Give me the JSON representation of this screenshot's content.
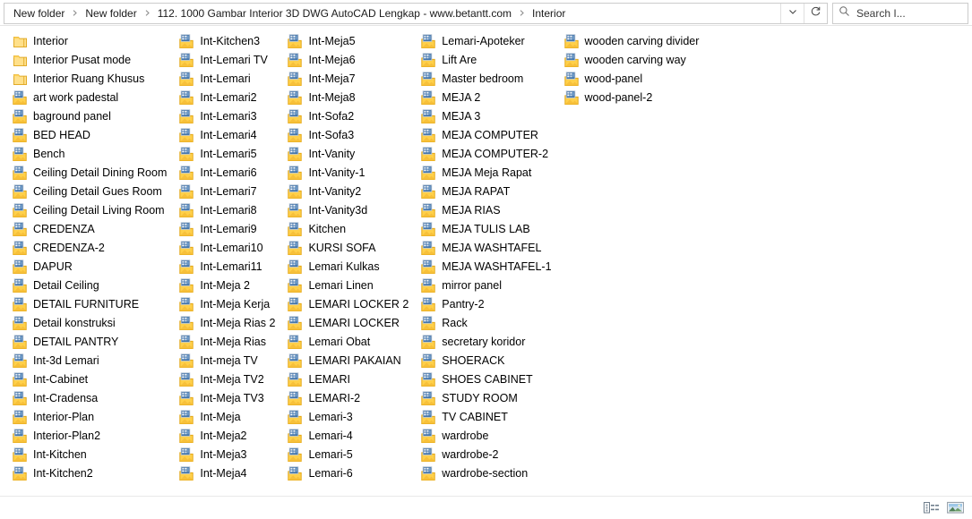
{
  "window": {
    "title": "Interior"
  },
  "addressbar": {
    "breadcrumbs": [
      {
        "label": "New folder"
      },
      {
        "label": "New folder"
      },
      {
        "label": "112. 1000 Gambar Interior 3D DWG AutoCAD Lengkap - www.betantt.com"
      },
      {
        "label": "Interior"
      }
    ],
    "separator_icon": "chevron-right-icon",
    "history_dropdown_icon": "chevron-down-icon",
    "refresh_icon": "refresh-icon"
  },
  "search": {
    "icon": "search-icon",
    "value": "",
    "placeholder": "Search I..."
  },
  "statusbar": {
    "view_details_icon": "details-view-icon",
    "view_large_icons_icon": "large-icons-view-icon"
  },
  "icons": {
    "folder_plain": "folder-icon",
    "folder_thumbnail": "folder-with-picture-icon"
  },
  "filelist": {
    "columns": [
      {
        "items": [
          {
            "name": "Interior",
            "icon": "folder-icon"
          },
          {
            "name": "Interior Pusat mode",
            "icon": "folder-icon"
          },
          {
            "name": "Interior Ruang Khusus",
            "icon": "folder-icon"
          },
          {
            "name": "art work padestal",
            "icon": "folder-with-picture-icon"
          },
          {
            "name": "baground panel",
            "icon": "folder-with-picture-icon"
          },
          {
            "name": "BED HEAD",
            "icon": "folder-with-picture-icon"
          },
          {
            "name": "Bench",
            "icon": "folder-with-picture-icon"
          },
          {
            "name": "Ceiling Detail Dining Room",
            "icon": "folder-with-picture-icon"
          },
          {
            "name": "Ceiling Detail Gues Room",
            "icon": "folder-with-picture-icon"
          },
          {
            "name": "Ceiling Detail Living Room",
            "icon": "folder-with-picture-icon"
          },
          {
            "name": "CREDENZA",
            "icon": "folder-with-picture-icon"
          },
          {
            "name": "CREDENZA-2",
            "icon": "folder-with-picture-icon"
          },
          {
            "name": "DAPUR",
            "icon": "folder-with-picture-icon"
          },
          {
            "name": "Detail Ceiling",
            "icon": "folder-with-picture-icon"
          },
          {
            "name": "DETAIL FURNITURE",
            "icon": "folder-with-picture-icon"
          },
          {
            "name": "Detail konstruksi",
            "icon": "folder-with-picture-icon"
          },
          {
            "name": "DETAIL PANTRY",
            "icon": "folder-with-picture-icon"
          },
          {
            "name": "Int-3d Lemari",
            "icon": "folder-with-picture-icon"
          },
          {
            "name": "Int-Cabinet",
            "icon": "folder-with-picture-icon"
          },
          {
            "name": "Int-Cradensa",
            "icon": "folder-with-picture-icon"
          },
          {
            "name": "Interior-Plan",
            "icon": "folder-with-picture-icon"
          },
          {
            "name": "Interior-Plan2",
            "icon": "folder-with-picture-icon"
          },
          {
            "name": "Int-Kitchen",
            "icon": "folder-with-picture-icon"
          },
          {
            "name": "Int-Kitchen2",
            "icon": "folder-with-picture-icon"
          }
        ]
      },
      {
        "items": [
          {
            "name": "Int-Kitchen3",
            "icon": "folder-with-picture-icon"
          },
          {
            "name": "Int-Lemari TV",
            "icon": "folder-with-picture-icon"
          },
          {
            "name": "Int-Lemari",
            "icon": "folder-with-picture-icon"
          },
          {
            "name": "Int-Lemari2",
            "icon": "folder-with-picture-icon"
          },
          {
            "name": "Int-Lemari3",
            "icon": "folder-with-picture-icon"
          },
          {
            "name": "Int-Lemari4",
            "icon": "folder-with-picture-icon"
          },
          {
            "name": "Int-Lemari5",
            "icon": "folder-with-picture-icon"
          },
          {
            "name": "Int-Lemari6",
            "icon": "folder-with-picture-icon"
          },
          {
            "name": "Int-Lemari7",
            "icon": "folder-with-picture-icon"
          },
          {
            "name": "Int-Lemari8",
            "icon": "folder-with-picture-icon"
          },
          {
            "name": "Int-Lemari9",
            "icon": "folder-with-picture-icon"
          },
          {
            "name": "Int-Lemari10",
            "icon": "folder-with-picture-icon"
          },
          {
            "name": "Int-Lemari11",
            "icon": "folder-with-picture-icon"
          },
          {
            "name": "Int-Meja 2",
            "icon": "folder-with-picture-icon"
          },
          {
            "name": "Int-Meja Kerja",
            "icon": "folder-with-picture-icon"
          },
          {
            "name": "Int-Meja Rias 2",
            "icon": "folder-with-picture-icon"
          },
          {
            "name": "Int-Meja Rias",
            "icon": "folder-with-picture-icon"
          },
          {
            "name": "Int-meja TV",
            "icon": "folder-with-picture-icon"
          },
          {
            "name": "Int-Meja TV2",
            "icon": "folder-with-picture-icon"
          },
          {
            "name": "Int-Meja TV3",
            "icon": "folder-with-picture-icon"
          },
          {
            "name": "Int-Meja",
            "icon": "folder-with-picture-icon"
          },
          {
            "name": "Int-Meja2",
            "icon": "folder-with-picture-icon"
          },
          {
            "name": "Int-Meja3",
            "icon": "folder-with-picture-icon"
          },
          {
            "name": "Int-Meja4",
            "icon": "folder-with-picture-icon"
          }
        ]
      },
      {
        "items": [
          {
            "name": "Int-Meja5",
            "icon": "folder-with-picture-icon"
          },
          {
            "name": "Int-Meja6",
            "icon": "folder-with-picture-icon"
          },
          {
            "name": "Int-Meja7",
            "icon": "folder-with-picture-icon"
          },
          {
            "name": "Int-Meja8",
            "icon": "folder-with-picture-icon"
          },
          {
            "name": "Int-Sofa2",
            "icon": "folder-with-picture-icon"
          },
          {
            "name": "Int-Sofa3",
            "icon": "folder-with-picture-icon"
          },
          {
            "name": "Int-Vanity",
            "icon": "folder-with-picture-icon"
          },
          {
            "name": "Int-Vanity-1",
            "icon": "folder-with-picture-icon"
          },
          {
            "name": "Int-Vanity2",
            "icon": "folder-with-picture-icon"
          },
          {
            "name": "Int-Vanity3d",
            "icon": "folder-with-picture-icon"
          },
          {
            "name": "Kitchen",
            "icon": "folder-with-picture-icon"
          },
          {
            "name": "KURSI SOFA",
            "icon": "folder-with-picture-icon"
          },
          {
            "name": "Lemari Kulkas",
            "icon": "folder-with-picture-icon"
          },
          {
            "name": "Lemari Linen",
            "icon": "folder-with-picture-icon"
          },
          {
            "name": "LEMARI LOCKER 2",
            "icon": "folder-with-picture-icon"
          },
          {
            "name": "LEMARI LOCKER",
            "icon": "folder-with-picture-icon"
          },
          {
            "name": "Lemari Obat",
            "icon": "folder-with-picture-icon"
          },
          {
            "name": "LEMARI PAKAIAN",
            "icon": "folder-with-picture-icon"
          },
          {
            "name": "LEMARI",
            "icon": "folder-with-picture-icon"
          },
          {
            "name": "LEMARI-2",
            "icon": "folder-with-picture-icon"
          },
          {
            "name": "Lemari-3",
            "icon": "folder-with-picture-icon"
          },
          {
            "name": "Lemari-4",
            "icon": "folder-with-picture-icon"
          },
          {
            "name": "Lemari-5",
            "icon": "folder-with-picture-icon"
          },
          {
            "name": "Lemari-6",
            "icon": "folder-with-picture-icon"
          }
        ]
      },
      {
        "items": [
          {
            "name": "Lemari-Apoteker",
            "icon": "folder-with-picture-icon"
          },
          {
            "name": "Lift Are",
            "icon": "folder-with-picture-icon"
          },
          {
            "name": "Master bedroom",
            "icon": "folder-with-picture-icon"
          },
          {
            "name": "MEJA 2",
            "icon": "folder-with-picture-icon"
          },
          {
            "name": "MEJA 3",
            "icon": "folder-with-picture-icon"
          },
          {
            "name": "MEJA COMPUTER",
            "icon": "folder-with-picture-icon"
          },
          {
            "name": "MEJA COMPUTER-2",
            "icon": "folder-with-picture-icon"
          },
          {
            "name": "MEJA Meja Rapat",
            "icon": "folder-with-picture-icon"
          },
          {
            "name": "MEJA RAPAT",
            "icon": "folder-with-picture-icon"
          },
          {
            "name": "MEJA RIAS",
            "icon": "folder-with-picture-icon"
          },
          {
            "name": "MEJA TULIS LAB",
            "icon": "folder-with-picture-icon"
          },
          {
            "name": "MEJA WASHTAFEL",
            "icon": "folder-with-picture-icon"
          },
          {
            "name": "MEJA WASHTAFEL-1",
            "icon": "folder-with-picture-icon"
          },
          {
            "name": "mirror panel",
            "icon": "folder-with-picture-icon"
          },
          {
            "name": "Pantry-2",
            "icon": "folder-with-picture-icon"
          },
          {
            "name": "Rack",
            "icon": "folder-with-picture-icon"
          },
          {
            "name": "secretary koridor",
            "icon": "folder-with-picture-icon"
          },
          {
            "name": "SHOERACK",
            "icon": "folder-with-picture-icon"
          },
          {
            "name": "SHOES CABINET",
            "icon": "folder-with-picture-icon"
          },
          {
            "name": "STUDY ROOM",
            "icon": "folder-with-picture-icon"
          },
          {
            "name": "TV CABINET",
            "icon": "folder-with-picture-icon"
          },
          {
            "name": "wardrobe",
            "icon": "folder-with-picture-icon"
          },
          {
            "name": "wardrobe-2",
            "icon": "folder-with-picture-icon"
          },
          {
            "name": "wardrobe-section",
            "icon": "folder-with-picture-icon"
          }
        ]
      },
      {
        "items": [
          {
            "name": "wooden carving divider",
            "icon": "folder-with-picture-icon"
          },
          {
            "name": "wooden carving way",
            "icon": "folder-with-picture-icon"
          },
          {
            "name": "wood-panel",
            "icon": "folder-with-picture-icon"
          },
          {
            "name": "wood-panel-2",
            "icon": "folder-with-picture-icon"
          }
        ]
      }
    ]
  },
  "colors": {
    "folder_yellow": "#ffd04a",
    "folder_yellow_dark": "#e8a900",
    "thumbnail_blue": "#3f6fa8",
    "text": "#000000",
    "border": "#cccccc"
  }
}
